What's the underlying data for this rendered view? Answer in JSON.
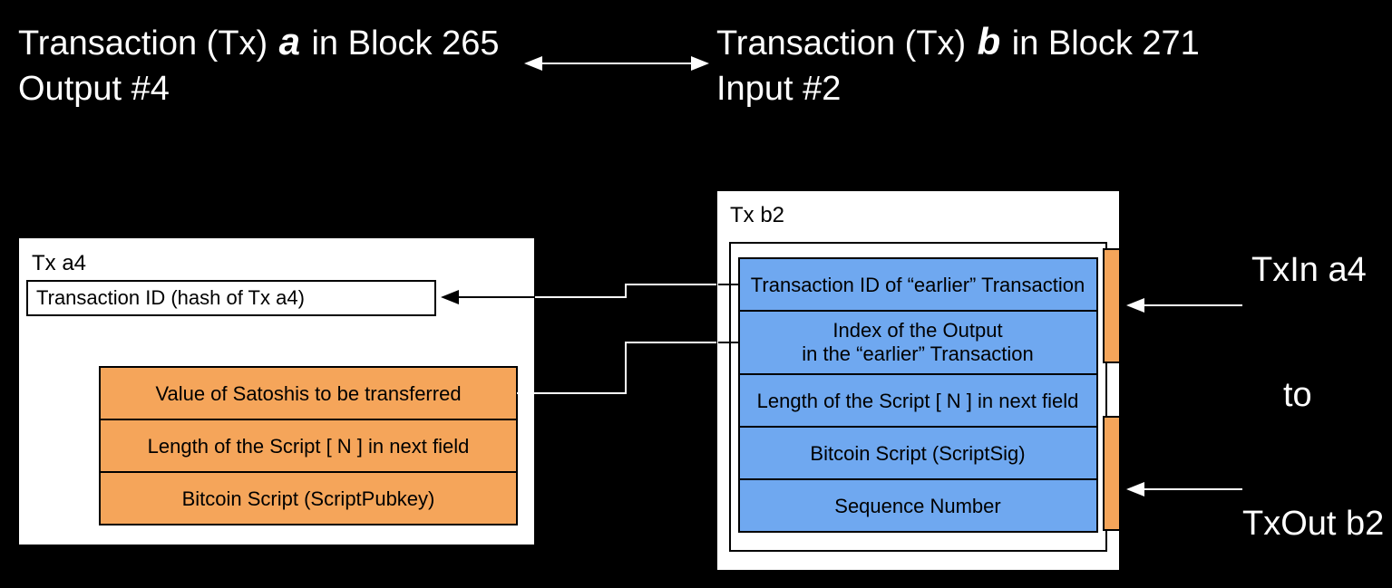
{
  "left_header": {
    "a": "Transaction (Tx)",
    "b": "a",
    "c": "in Block 265",
    "d": "Output #4"
  },
  "right_header": {
    "a": "Transaction (Tx)",
    "b": "b",
    "c": "in Block 271",
    "d": "Input #2"
  },
  "tx_a": {
    "label": "Tx  a4",
    "txid": "Transaction ID (hash of Tx a4)",
    "rows": [
      "Value of Satoshis to be transferred",
      "Length of the Script [ N ] in next field",
      "Bitcoin Script (ScriptPubkey)"
    ]
  },
  "tx_b": {
    "label": "Tx  b2",
    "rows": [
      "Transaction ID of “earlier” Transaction",
      "Index of the Output",
      "in the “earlier” Transaction",
      "Length of the Script [ N ] in next field",
      "Bitcoin Script (ScriptSig)",
      "Sequence Number"
    ]
  },
  "right_labels": {
    "top": "TxIn a4",
    "mid": "to",
    "bot": "TxOut b2"
  }
}
